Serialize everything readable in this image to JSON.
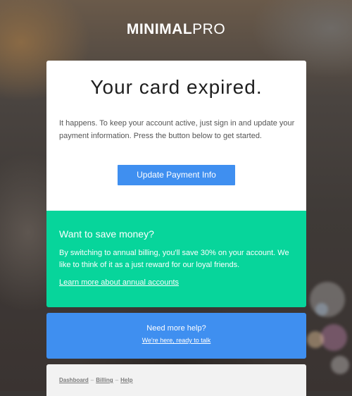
{
  "brand": {
    "bold": "MINIMAL",
    "light": "PRO"
  },
  "main": {
    "title": "Your card expired.",
    "body": "It happens. To keep your account active, just sign in and update your payment information. Press the button below to get started.",
    "button_label": "Update Payment Info"
  },
  "promo": {
    "heading": "Want to save money?",
    "body": "By switching to annual billing, you'll save 30% on your account. We like to think of it as a just reward for our loyal friends.",
    "link": "Learn more about annual accounts"
  },
  "help": {
    "question": "Need more help?",
    "link": "We're here, ready to talk"
  },
  "footer": {
    "links": [
      "Dashboard",
      "Billing",
      "Help"
    ],
    "separator": "–"
  },
  "colors": {
    "primary_blue": "#3f8ff0",
    "green": "#07d59b",
    "card_white": "#ffffff",
    "footer_gray": "#f2f2f2"
  }
}
